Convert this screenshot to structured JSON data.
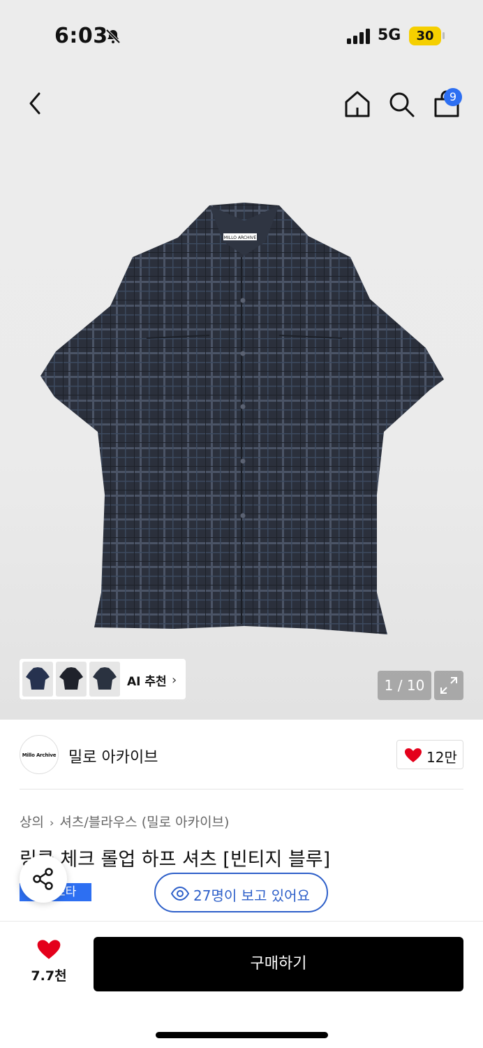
{
  "status_bar": {
    "time": "6:03",
    "network": "5G",
    "battery": "30"
  },
  "nav": {
    "cart_count": "9"
  },
  "gallery": {
    "product_label": "MILLO ARCHIVE",
    "ai_recommend": "AI 추천",
    "pager": "1 / 10"
  },
  "brand": {
    "logo_text": "Millo Archive",
    "name": "밀로 아카이브",
    "likes": "12만"
  },
  "breadcrumb": {
    "category": "상의",
    "subcategory": "셔츠/블라우스 (밀로 아카이브)"
  },
  "product": {
    "title": "링클 체크 롤업 하프 셔츠 [빈티지 블루]",
    "tag": "스타"
  },
  "viewers": {
    "text": "27명이 보고 있어요"
  },
  "bottom": {
    "wish_count": "7.7천",
    "buy_label": "구매하기"
  },
  "colors": {
    "accent": "#2d6ff2",
    "viewer_blue": "#2d5fc9",
    "heart": "#e4001b",
    "battery": "#f5cf00"
  },
  "icons": [
    "bell-off-icon",
    "signal-icon",
    "back-icon",
    "home-icon",
    "search-icon",
    "shopping-bag-icon",
    "chevron-right-icon",
    "expand-icon",
    "heart-icon",
    "share-icon",
    "eye-icon"
  ]
}
